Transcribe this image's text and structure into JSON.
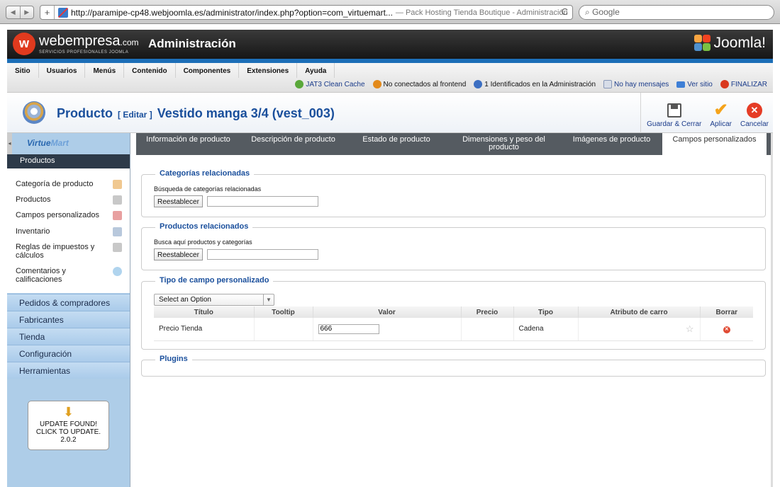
{
  "browser": {
    "url": "http://paramipe-cp48.webjoomla.es/administrator/index.php?option=com_virtuemart...",
    "page_title": "— Pack Hosting Tienda Boutique - Administración",
    "search_placeholder": "Google",
    "back_glyph": "◀",
    "forward_glyph": "▶",
    "plus_glyph": "+",
    "reload_glyph": "C"
  },
  "header": {
    "brand_name": "webempresa",
    "brand_suffix": ".com",
    "brand_tagline": "SERVICIOS PROFESIONALES JOOMLA",
    "title": "Administración",
    "joomla_label": "Joomla!"
  },
  "menu": {
    "items": [
      "Sitio",
      "Usuarios",
      "Menús",
      "Contenido",
      "Componentes",
      "Extensiones",
      "Ayuda"
    ]
  },
  "status": {
    "cache": "JAT3 Clean Cache",
    "frontend": "No conectados al frontend",
    "admins": "1 Identificados en la Administración",
    "messages": "No hay mensajes",
    "view_site": "Ver sitio",
    "logout": "FINALIZAR"
  },
  "toolbar": {
    "title": "Producto",
    "edit_label": "[ Editar ]",
    "product_name": "Vestido manga 3/4 (vest_003)",
    "save_close": "Guardar & Cerrar",
    "apply": "Aplicar",
    "cancel": "Cancelar"
  },
  "sidebar": {
    "logo_main": "Virtue",
    "logo_accent": "Mart",
    "section_title": "Productos",
    "products_items": [
      "Categoría de producto",
      "Productos",
      "Campos personalizados",
      "Inventario",
      "Reglas de impuestos y cálculos",
      "Comentarios y calificaciones"
    ],
    "sections": [
      "Pedidos & compradores",
      "Fabricantes",
      "Tienda",
      "Configuración",
      "Herramientas"
    ],
    "update_line1": "UPDATE FOUND!",
    "update_line2": "CLICK TO UPDATE.",
    "update_version": "2.0.2"
  },
  "tabs": [
    "Información de producto",
    "Descripción de producto",
    "Estado de producto",
    "Dimensiones y peso del producto",
    "Imágenes de producto",
    "Campos personalizados"
  ],
  "related_categories": {
    "legend": "Categorías relacionadas",
    "label": "Búsqueda de categorías relacionadas",
    "reset": "Reestablecer",
    "value": ""
  },
  "related_products": {
    "legend": "Productos relacionados",
    "label": "Busca aquí productos y categorías",
    "reset": "Reestablecer",
    "value": ""
  },
  "custom_field": {
    "legend": "Tipo de campo personalizado",
    "select_value": "Select an Option",
    "columns": [
      "Título",
      "Tooltip",
      "Valor",
      "Precio",
      "Tipo",
      "Atributo de carro",
      "Borrar"
    ],
    "rows": [
      {
        "title": "Precio Tienda",
        "tooltip": "",
        "value": "666",
        "price": "",
        "type": "Cadena",
        "cart_attribute": "",
        "delete": ""
      }
    ]
  },
  "plugins": {
    "legend": "Plugins"
  },
  "colors": {
    "accent_blue": "#1a4f9c",
    "header_stripe": "#1d6fb8",
    "cancel_red": "#e53c26",
    "apply_orange": "#f5a31a"
  }
}
